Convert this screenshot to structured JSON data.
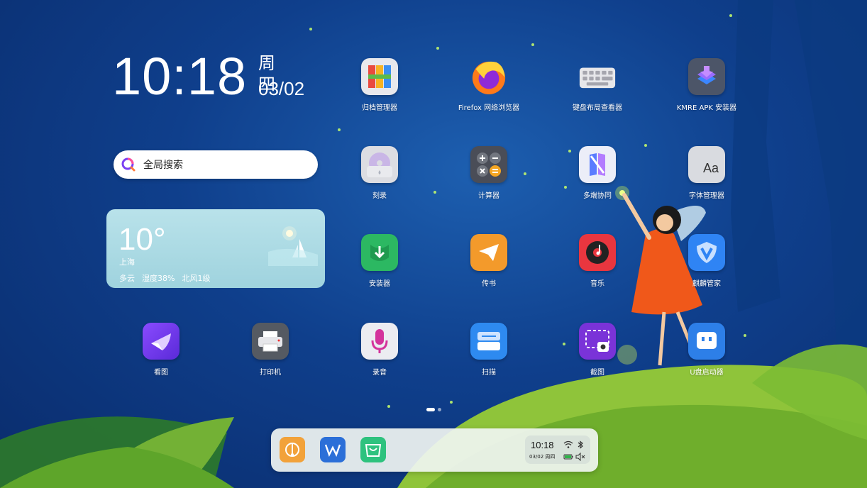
{
  "clock": {
    "time": "10:18",
    "weekday": "周四",
    "date": "03/02"
  },
  "search": {
    "label": "全局搜索",
    "icon": "search-icon"
  },
  "weather": {
    "temperature": "10°",
    "city": "上海",
    "condition": "多云",
    "humidity": "湿度38%",
    "wind": "北风1级"
  },
  "apps": [
    {
      "id": "archive-manager",
      "label": "归档管理器",
      "icon": "archive-icon"
    },
    {
      "id": "firefox",
      "label": "Firefox 网络浏览器",
      "icon": "firefox-icon"
    },
    {
      "id": "keyboard-layout-viewer",
      "label": "键盘布局查看器",
      "icon": "keyboard-icon"
    },
    {
      "id": "kmre-apk-installer",
      "label": "KMRE APK 安装器",
      "icon": "apk-installer-icon"
    },
    {
      "id": "burner",
      "label": "刻录",
      "icon": "disc-icon"
    },
    {
      "id": "calculator",
      "label": "计算器",
      "icon": "calculator-icon"
    },
    {
      "id": "multi-device",
      "label": "多端协同",
      "icon": "multi-device-icon"
    },
    {
      "id": "font-manager",
      "label": "字体管理器",
      "icon": "font-icon"
    },
    {
      "id": "installer",
      "label": "安装器",
      "icon": "download-icon"
    },
    {
      "id": "transfer",
      "label": "传书",
      "icon": "paper-plane-icon"
    },
    {
      "id": "music",
      "label": "音乐",
      "icon": "music-icon"
    },
    {
      "id": "kylin-manager",
      "label": "麒麟管家",
      "icon": "shield-icon"
    },
    {
      "id": "image-viewer",
      "label": "看图",
      "icon": "image-viewer-icon"
    },
    {
      "id": "printer",
      "label": "打印机",
      "icon": "printer-icon"
    },
    {
      "id": "recorder",
      "label": "录音",
      "icon": "microphone-icon"
    },
    {
      "id": "scanner",
      "label": "扫描",
      "icon": "scanner-icon"
    },
    {
      "id": "screenshot",
      "label": "截图",
      "icon": "screenshot-icon"
    },
    {
      "id": "usb-boot",
      "label": "U盘启动器",
      "icon": "usb-icon"
    }
  ],
  "dock": {
    "apps": [
      {
        "id": "kylin-center",
        "icon": "kylin-center-icon"
      },
      {
        "id": "wps",
        "icon": "wps-icon"
      },
      {
        "id": "software-store",
        "icon": "store-icon"
      }
    ],
    "tray": {
      "time": "10:18",
      "date": "03/02 周四",
      "icons": [
        "wifi-icon",
        "bluetooth-icon",
        "battery-icon",
        "volume-muted-icon"
      ]
    }
  },
  "page_indicator": {
    "pages": 2,
    "current": 1
  },
  "colors": {
    "background": "#0f3f8c",
    "weather_card": "#a9d9e3",
    "dress": "#f0581a",
    "grass": "#9ccc3a"
  }
}
